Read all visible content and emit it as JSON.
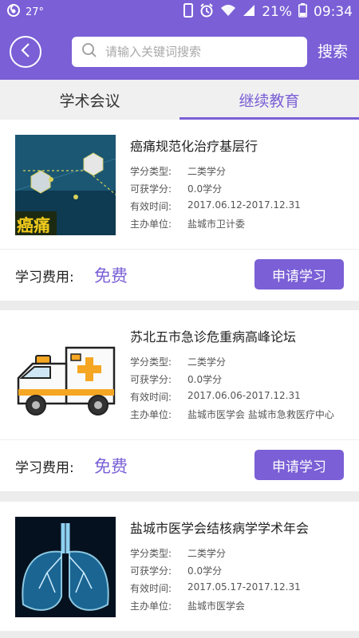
{
  "status_bar": {
    "temperature": "27°",
    "battery": "21%",
    "time": "09:34"
  },
  "header": {
    "search_placeholder": "请输入关键词搜索",
    "search_button": "搜索"
  },
  "tabs": [
    {
      "label": "学术会议",
      "active": false
    },
    {
      "label": "继续教育",
      "active": true
    }
  ],
  "labels": {
    "credit_type": "学分类型:",
    "credit_amount": "可获学分:",
    "valid_time": "有效时间:",
    "organizer": "主办单位:",
    "fee": "学习费用:",
    "apply": "申请学习"
  },
  "courses": [
    {
      "title": "癌痛规范化治疗基层行",
      "thumb_text": "癌痛",
      "credit_type": "二类学分",
      "credit_amount": "0.0学分",
      "valid_time": "2017.06.12-2017.12.31",
      "organizer": "盐城市卫计委",
      "fee": "免费"
    },
    {
      "title": "苏北五市急诊危重病高峰论坛",
      "credit_type": "二类学分",
      "credit_amount": "0.0学分",
      "valid_time": "2017.06.06-2017.12.31",
      "organizer": "盐城市医学会 盐城市急救医疗中心",
      "fee": "免费"
    },
    {
      "title": "盐城市医学会结核病学学术年会",
      "credit_type": "二类学分",
      "credit_amount": "0.0学分",
      "valid_time": "2017.05.17-2017.12.31",
      "organizer": "盐城市医学会"
    }
  ],
  "colors": {
    "accent": "#7a5fd6",
    "background": "#ececec"
  }
}
